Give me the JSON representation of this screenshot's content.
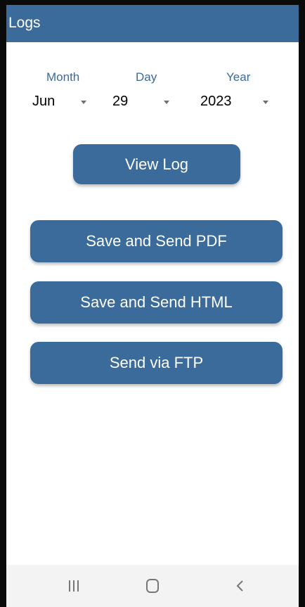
{
  "appbar": {
    "title": "Logs"
  },
  "date": {
    "month": {
      "label": "Month",
      "value": "Jun"
    },
    "day": {
      "label": "Day",
      "value": "29"
    },
    "year": {
      "label": "Year",
      "value": "2023"
    }
  },
  "buttons": {
    "view_log": "View Log",
    "save_pdf": "Save and Send PDF",
    "save_html": "Save and Send HTML",
    "send_ftp": "Send via FTP"
  },
  "colors": {
    "accent": "#3a6b9a",
    "background": "#ffffff",
    "navbar": "#f3f3f3"
  },
  "navbar": {
    "icons": [
      "recent-apps-icon",
      "home-icon",
      "back-icon"
    ]
  }
}
